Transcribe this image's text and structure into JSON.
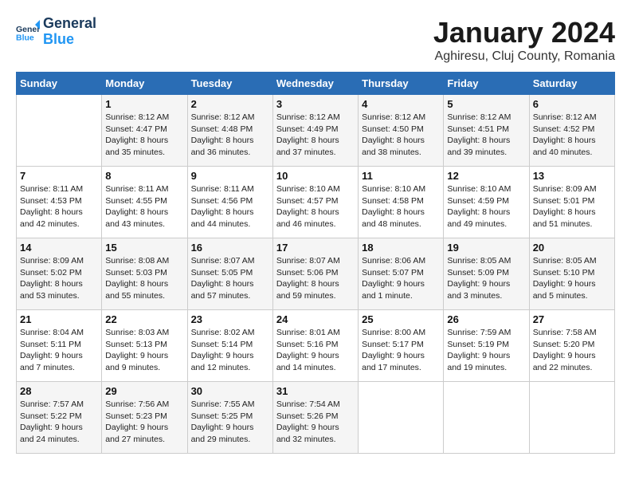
{
  "logo": {
    "line1": "General",
    "line2": "Blue"
  },
  "title": "January 2024",
  "subtitle": "Aghiresu, Cluj County, Romania",
  "weekdays": [
    "Sunday",
    "Monday",
    "Tuesday",
    "Wednesday",
    "Thursday",
    "Friday",
    "Saturday"
  ],
  "weeks": [
    [
      {
        "day": "",
        "info": ""
      },
      {
        "day": "1",
        "info": "Sunrise: 8:12 AM\nSunset: 4:47 PM\nDaylight: 8 hours\nand 35 minutes."
      },
      {
        "day": "2",
        "info": "Sunrise: 8:12 AM\nSunset: 4:48 PM\nDaylight: 8 hours\nand 36 minutes."
      },
      {
        "day": "3",
        "info": "Sunrise: 8:12 AM\nSunset: 4:49 PM\nDaylight: 8 hours\nand 37 minutes."
      },
      {
        "day": "4",
        "info": "Sunrise: 8:12 AM\nSunset: 4:50 PM\nDaylight: 8 hours\nand 38 minutes."
      },
      {
        "day": "5",
        "info": "Sunrise: 8:12 AM\nSunset: 4:51 PM\nDaylight: 8 hours\nand 39 minutes."
      },
      {
        "day": "6",
        "info": "Sunrise: 8:12 AM\nSunset: 4:52 PM\nDaylight: 8 hours\nand 40 minutes."
      }
    ],
    [
      {
        "day": "7",
        "info": "Sunrise: 8:11 AM\nSunset: 4:53 PM\nDaylight: 8 hours\nand 42 minutes."
      },
      {
        "day": "8",
        "info": "Sunrise: 8:11 AM\nSunset: 4:55 PM\nDaylight: 8 hours\nand 43 minutes."
      },
      {
        "day": "9",
        "info": "Sunrise: 8:11 AM\nSunset: 4:56 PM\nDaylight: 8 hours\nand 44 minutes."
      },
      {
        "day": "10",
        "info": "Sunrise: 8:10 AM\nSunset: 4:57 PM\nDaylight: 8 hours\nand 46 minutes."
      },
      {
        "day": "11",
        "info": "Sunrise: 8:10 AM\nSunset: 4:58 PM\nDaylight: 8 hours\nand 48 minutes."
      },
      {
        "day": "12",
        "info": "Sunrise: 8:10 AM\nSunset: 4:59 PM\nDaylight: 8 hours\nand 49 minutes."
      },
      {
        "day": "13",
        "info": "Sunrise: 8:09 AM\nSunset: 5:01 PM\nDaylight: 8 hours\nand 51 minutes."
      }
    ],
    [
      {
        "day": "14",
        "info": "Sunrise: 8:09 AM\nSunset: 5:02 PM\nDaylight: 8 hours\nand 53 minutes."
      },
      {
        "day": "15",
        "info": "Sunrise: 8:08 AM\nSunset: 5:03 PM\nDaylight: 8 hours\nand 55 minutes."
      },
      {
        "day": "16",
        "info": "Sunrise: 8:07 AM\nSunset: 5:05 PM\nDaylight: 8 hours\nand 57 minutes."
      },
      {
        "day": "17",
        "info": "Sunrise: 8:07 AM\nSunset: 5:06 PM\nDaylight: 8 hours\nand 59 minutes."
      },
      {
        "day": "18",
        "info": "Sunrise: 8:06 AM\nSunset: 5:07 PM\nDaylight: 9 hours\nand 1 minute."
      },
      {
        "day": "19",
        "info": "Sunrise: 8:05 AM\nSunset: 5:09 PM\nDaylight: 9 hours\nand 3 minutes."
      },
      {
        "day": "20",
        "info": "Sunrise: 8:05 AM\nSunset: 5:10 PM\nDaylight: 9 hours\nand 5 minutes."
      }
    ],
    [
      {
        "day": "21",
        "info": "Sunrise: 8:04 AM\nSunset: 5:11 PM\nDaylight: 9 hours\nand 7 minutes."
      },
      {
        "day": "22",
        "info": "Sunrise: 8:03 AM\nSunset: 5:13 PM\nDaylight: 9 hours\nand 9 minutes."
      },
      {
        "day": "23",
        "info": "Sunrise: 8:02 AM\nSunset: 5:14 PM\nDaylight: 9 hours\nand 12 minutes."
      },
      {
        "day": "24",
        "info": "Sunrise: 8:01 AM\nSunset: 5:16 PM\nDaylight: 9 hours\nand 14 minutes."
      },
      {
        "day": "25",
        "info": "Sunrise: 8:00 AM\nSunset: 5:17 PM\nDaylight: 9 hours\nand 17 minutes."
      },
      {
        "day": "26",
        "info": "Sunrise: 7:59 AM\nSunset: 5:19 PM\nDaylight: 9 hours\nand 19 minutes."
      },
      {
        "day": "27",
        "info": "Sunrise: 7:58 AM\nSunset: 5:20 PM\nDaylight: 9 hours\nand 22 minutes."
      }
    ],
    [
      {
        "day": "28",
        "info": "Sunrise: 7:57 AM\nSunset: 5:22 PM\nDaylight: 9 hours\nand 24 minutes."
      },
      {
        "day": "29",
        "info": "Sunrise: 7:56 AM\nSunset: 5:23 PM\nDaylight: 9 hours\nand 27 minutes."
      },
      {
        "day": "30",
        "info": "Sunrise: 7:55 AM\nSunset: 5:25 PM\nDaylight: 9 hours\nand 29 minutes."
      },
      {
        "day": "31",
        "info": "Sunrise: 7:54 AM\nSunset: 5:26 PM\nDaylight: 9 hours\nand 32 minutes."
      },
      {
        "day": "",
        "info": ""
      },
      {
        "day": "",
        "info": ""
      },
      {
        "day": "",
        "info": ""
      }
    ]
  ]
}
